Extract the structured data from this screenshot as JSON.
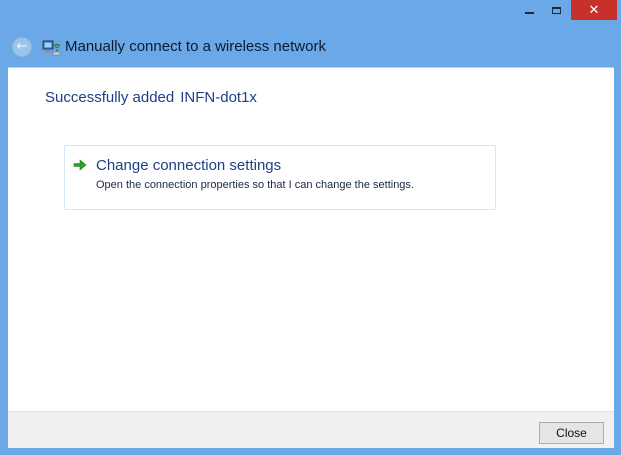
{
  "window": {
    "title": "Manually connect to a wireless network",
    "close_glyph": "✕"
  },
  "header": {
    "back_glyph": "←",
    "icons": {
      "back": "back-arrow-icon",
      "network": "wireless-network-icon"
    }
  },
  "content": {
    "success_prefix": "Successfully added",
    "network_name": "INFN-dot1x",
    "option": {
      "icon": "green-arrow-icon",
      "title": "Change connection settings",
      "description": "Open the connection properties so that I can change the settings."
    }
  },
  "footer": {
    "close_label": "Close"
  },
  "colors": {
    "frame": "#6aa8e8",
    "close_button": "#c7312a",
    "link_text": "#1e3f86",
    "arrow_green": "#2e9e2e"
  }
}
